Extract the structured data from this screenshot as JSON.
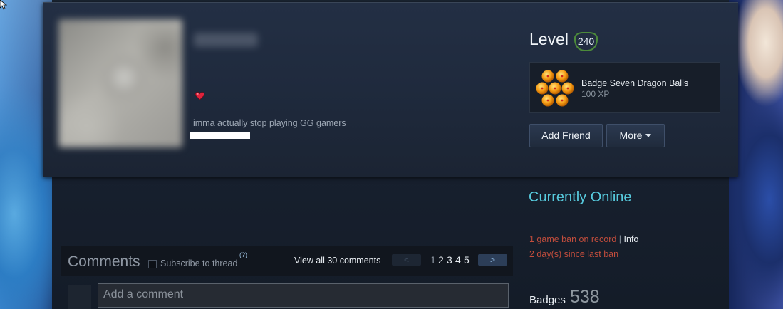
{
  "profile": {
    "persona_name": "",
    "summary": "imma actually stop playing GG gamers",
    "level_label": "Level",
    "level": "240"
  },
  "featured_badge": {
    "name": "Badge Seven Dragon Balls",
    "xp": "100 XP",
    "icon": "dragonballs-icon"
  },
  "actions": {
    "add_friend": "Add Friend",
    "more": "More"
  },
  "status": {
    "online": "Currently Online",
    "ban_record": "1 game ban on record",
    "ban_separator": "|",
    "ban_info": "Info",
    "days_since_ban": "2 day(s) since last ban"
  },
  "badges": {
    "label": "Badges",
    "count": "538"
  },
  "comments": {
    "title": "Comments",
    "subscribe": "Subscribe to thread",
    "help": "(?)",
    "view_all": "View all 30 comments",
    "prev": "<",
    "next": ">",
    "pages": [
      "1",
      "2",
      "3",
      "4",
      "5"
    ],
    "current_page": "1",
    "input_placeholder": "Add a comment"
  },
  "colors": {
    "online": "#57cbde",
    "ban": "#c24d3c",
    "level_ring": "#4c8a3a"
  }
}
